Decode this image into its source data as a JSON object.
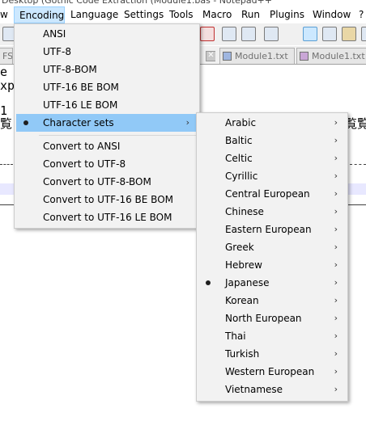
{
  "window": {
    "title": "Desktop (Gothic Code Extraction (Module1.bas - Notepad++"
  },
  "menubar": {
    "items": [
      "w",
      "Encoding",
      "Language",
      "Settings",
      "Tools",
      "Macro",
      "Run",
      "Plugins",
      "Window",
      "?"
    ]
  },
  "tabs": [
    {
      "label": "FS",
      "close": "✕"
    },
    {
      "label": "Module1.txt",
      "close": "✕"
    },
    {
      "label": "Module1.txt",
      "close": "✕"
    }
  ],
  "editor": {
    "lines": [
      "e",
      "xp",
      "1",
      "覧",
      "覧覧"
    ]
  },
  "encoding_menu": {
    "group1": [
      "ANSI",
      "UTF-8",
      "UTF-8-BOM",
      "UTF-16 BE BOM",
      "UTF-16 LE BOM"
    ],
    "character_sets": {
      "label": "Character sets",
      "arrow": "›"
    },
    "group2": [
      "Convert to ANSI",
      "Convert to UTF-8",
      "Convert to UTF-8-BOM",
      "Convert to UTF-16 BE BOM",
      "Convert to UTF-16 LE BOM"
    ]
  },
  "charsets_menu": {
    "items": [
      "Arabic",
      "Baltic",
      "Celtic",
      "Cyrillic",
      "Central European",
      "Chinese",
      "Eastern European",
      "Greek",
      "Hebrew",
      "Japanese",
      "Korean",
      "North European",
      "Thai",
      "Turkish",
      "Western European",
      "Vietnamese"
    ],
    "arrow": "›",
    "selected": "Japanese"
  },
  "colors": {
    "menu_bg": "#f2f2f2",
    "hover": "#91c9f7",
    "menubar_active": "#cce8ff"
  }
}
